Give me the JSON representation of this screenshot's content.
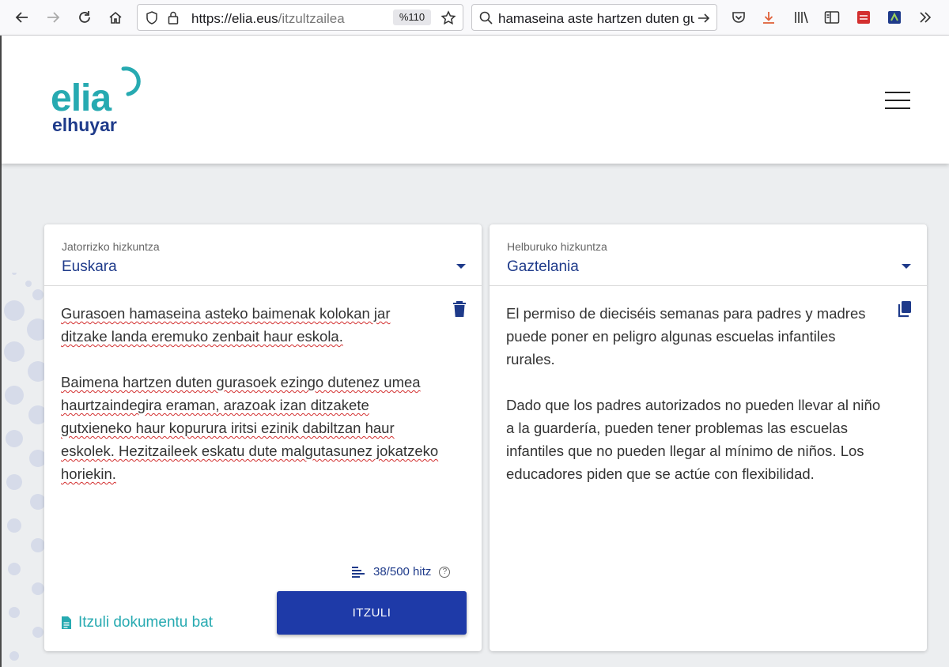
{
  "browser": {
    "url_domain": "https://elia.eus",
    "url_path": "/itzultzailea",
    "zoom": "%110",
    "search_text": "hamaseina aste hartzen duten gurasoek"
  },
  "site": {
    "logo_name": "elia",
    "logo_sub": "elhuyar"
  },
  "source": {
    "caption": "Jatorrizko hizkuntza",
    "language": "Euskara",
    "paragraph1": "Gurasoen hamaseina asteko baimenak kolokan jar ditzake landa eremuko zenbait haur eskola.",
    "paragraph2": "Baimena hartzen duten gurasoek ezingo dutenez umea haurtzaindegira eraman, arazoak izan ditzakete gutxieneko haur kopurura iritsi ezinik dabiltzan haur eskolek. Hezitzaileek eskatu dute malgutasunez jokatzeko horiekin.",
    "word_count": "38/500 hitz",
    "translate_button": "ITZULI",
    "document_link": "Itzuli dokumentu bat"
  },
  "target": {
    "caption": "Helburuko hizkuntza",
    "language": "Gaztelania",
    "paragraph1": "El permiso de dieciséis semanas para padres y madres puede poner en peligro algunas escuelas infantiles rurales.",
    "paragraph2": "Dado que los padres autorizados no pueden llevar al niño a la guardería, pueden tener problemas las escuelas infantiles que no pueden llegar al mínimo de niños. Los educadores piden que se actúe con flexibilidad."
  },
  "colors": {
    "brand_teal": "#27aab1",
    "brand_navy": "#1e3a8a",
    "button_blue": "#1e3aa8"
  }
}
